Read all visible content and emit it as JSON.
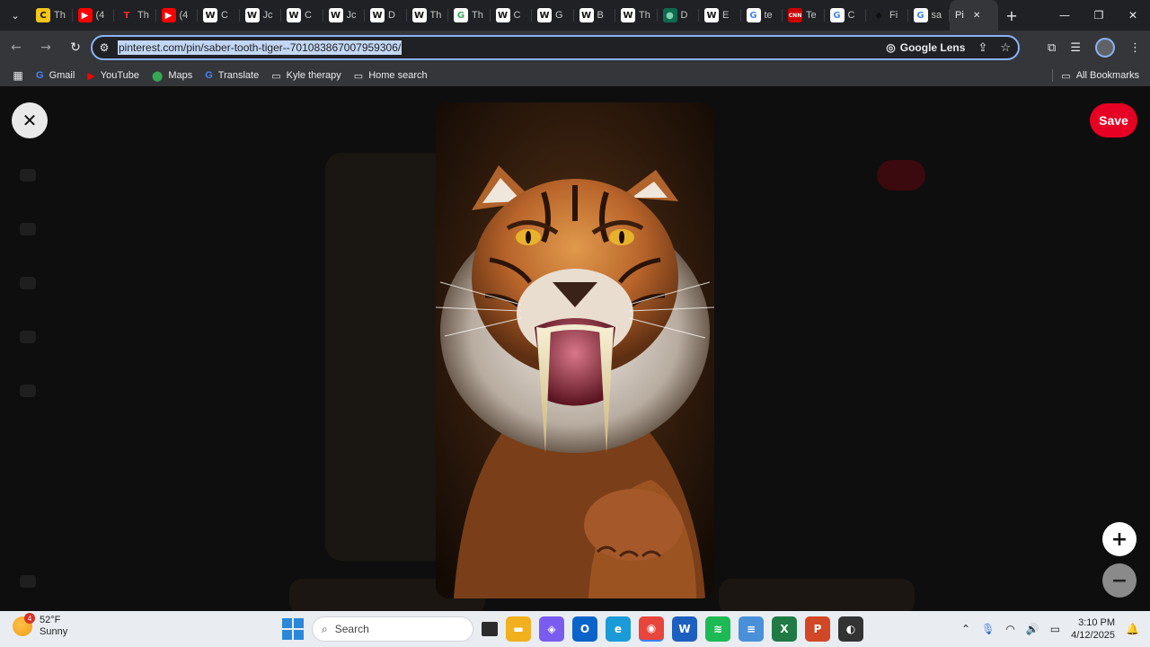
{
  "browser": {
    "tabs": [
      {
        "favicon": "C",
        "title": "Th",
        "color": "#f5c518",
        "text_color": "#1a1a1a"
      },
      {
        "favicon": "▶",
        "title": "(4",
        "color": "#ff0000",
        "text_color": "#ffffff"
      },
      {
        "favicon": "T",
        "title": "Th",
        "color": "#202124",
        "text_color": "#ff2a2a"
      },
      {
        "favicon": "▶",
        "title": "(4",
        "color": "#ff0000",
        "text_color": "#ffffff"
      },
      {
        "favicon": "W",
        "title": "C",
        "color": "#ffffff",
        "text_color": "#111111"
      },
      {
        "favicon": "W",
        "title": "Jc",
        "color": "#ffffff",
        "text_color": "#111111"
      },
      {
        "favicon": "W",
        "title": "C",
        "color": "#ffffff",
        "text_color": "#111111"
      },
      {
        "favicon": "W",
        "title": "Jc",
        "color": "#ffffff",
        "text_color": "#111111"
      },
      {
        "favicon": "W",
        "title": "D",
        "color": "#ffffff",
        "text_color": "#111111"
      },
      {
        "favicon": "W",
        "title": "Th",
        "color": "#ffffff",
        "text_color": "#111111"
      },
      {
        "favicon": "G",
        "title": "Th",
        "color": "#ffffff",
        "text_color": "#34a853"
      },
      {
        "favicon": "W",
        "title": "C",
        "color": "#ffffff",
        "text_color": "#111111"
      },
      {
        "favicon": "W",
        "title": "G",
        "color": "#ffffff",
        "text_color": "#111111"
      },
      {
        "favicon": "W",
        "title": "B",
        "color": "#ffffff",
        "text_color": "#111111"
      },
      {
        "favicon": "W",
        "title": "Th",
        "color": "#ffffff",
        "text_color": "#111111"
      },
      {
        "favicon": "●",
        "title": "D",
        "color": "#0f6b4f",
        "text_color": "#7fd1b0"
      },
      {
        "favicon": "W",
        "title": "E",
        "color": "#ffffff",
        "text_color": "#111111"
      },
      {
        "favicon": "G",
        "title": "te",
        "color": "#ffffff",
        "text_color": "#4285f4"
      },
      {
        "favicon": "CNN",
        "title": "Te",
        "color": "#cc0000",
        "text_color": "#ffffff"
      },
      {
        "favicon": "G",
        "title": "C",
        "color": "#ffffff",
        "text_color": "#4285f4"
      },
      {
        "favicon": "◆",
        "title": "Fi",
        "color": "#202124",
        "text_color": "#111111"
      },
      {
        "favicon": "G",
        "title": "sa",
        "color": "#ffffff",
        "text_color": "#4285f4"
      }
    ],
    "active_tab": {
      "title": "Pi"
    },
    "url": "pinterest.com/pin/saber-tooth-tiger--701083867007959306/",
    "google_lens_label": "Google Lens",
    "accent_color": "#8ab4f8"
  },
  "bookmarks": {
    "items": [
      {
        "label": "Gmail",
        "icon": "G"
      },
      {
        "label": "YouTube",
        "icon": "▶"
      },
      {
        "label": "Maps",
        "icon": "⬤"
      },
      {
        "label": "Translate",
        "icon": "G"
      },
      {
        "label": "Kyle therapy",
        "icon": "folder"
      },
      {
        "label": "Home search",
        "icon": "folder"
      }
    ],
    "all_label": "All Bookmarks"
  },
  "pin_viewer": {
    "save_label": "Save",
    "save_color": "#e60023",
    "close_icon": "close-icon",
    "zoom_in_icon": "plus-icon",
    "zoom_out_icon": "minus-icon"
  },
  "taskbar": {
    "weather": {
      "temp": "52°F",
      "condition": "Sunny",
      "badge": "4"
    },
    "search_placeholder": "Search",
    "apps": [
      {
        "name": "file-explorer-icon",
        "glyph": "▬",
        "color": "#f2b01e"
      },
      {
        "name": "copilot-icon",
        "glyph": "◈",
        "color": "#7b5cf0"
      },
      {
        "name": "outlook-icon",
        "glyph": "O",
        "color": "#0a64c9"
      },
      {
        "name": "edge-icon",
        "glyph": "e",
        "color": "#1a9bd8"
      },
      {
        "name": "chrome-icon",
        "glyph": "◉",
        "color": "#e8453c"
      },
      {
        "name": "word-icon",
        "glyph": "W",
        "color": "#1d5fbf"
      },
      {
        "name": "spotify-icon",
        "glyph": "≋",
        "color": "#1db954"
      },
      {
        "name": "notepad-icon",
        "glyph": "≡",
        "color": "#4a90d9"
      },
      {
        "name": "excel-icon",
        "glyph": "X",
        "color": "#1f7a44"
      },
      {
        "name": "powerpoint-icon",
        "glyph": "P",
        "color": "#d24726"
      },
      {
        "name": "app-icon",
        "glyph": "◐",
        "color": "#333333"
      }
    ],
    "clock": {
      "time": "3:10 PM",
      "date": "4/12/2025"
    }
  }
}
